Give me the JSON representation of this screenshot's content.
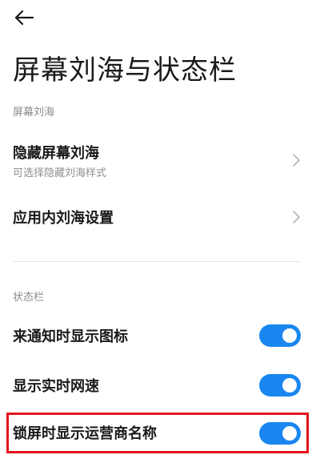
{
  "header": {
    "back_icon": "arrow-left-icon",
    "title": "屏幕刘海与状态栏"
  },
  "sections": {
    "notch": {
      "label": "屏幕刘海",
      "items": [
        {
          "title": "隐藏屏幕刘海",
          "subtitle": "可选择隐藏刘海样式",
          "icon": "chevron-right-icon"
        },
        {
          "title": "应用内刘海设置",
          "icon": "chevron-right-icon"
        }
      ]
    },
    "status_bar": {
      "label": "状态栏",
      "items": [
        {
          "title": "来通知时显示图标",
          "toggle": "on"
        },
        {
          "title": "显示实时网速",
          "toggle": "on"
        },
        {
          "title": "锁屏时显示运营商名称",
          "toggle": "on",
          "highlighted": true
        }
      ]
    }
  },
  "colors": {
    "toggle_on": "#1a86f0",
    "highlight_border": "#e4141b",
    "section_label": "#8a8a8a"
  }
}
